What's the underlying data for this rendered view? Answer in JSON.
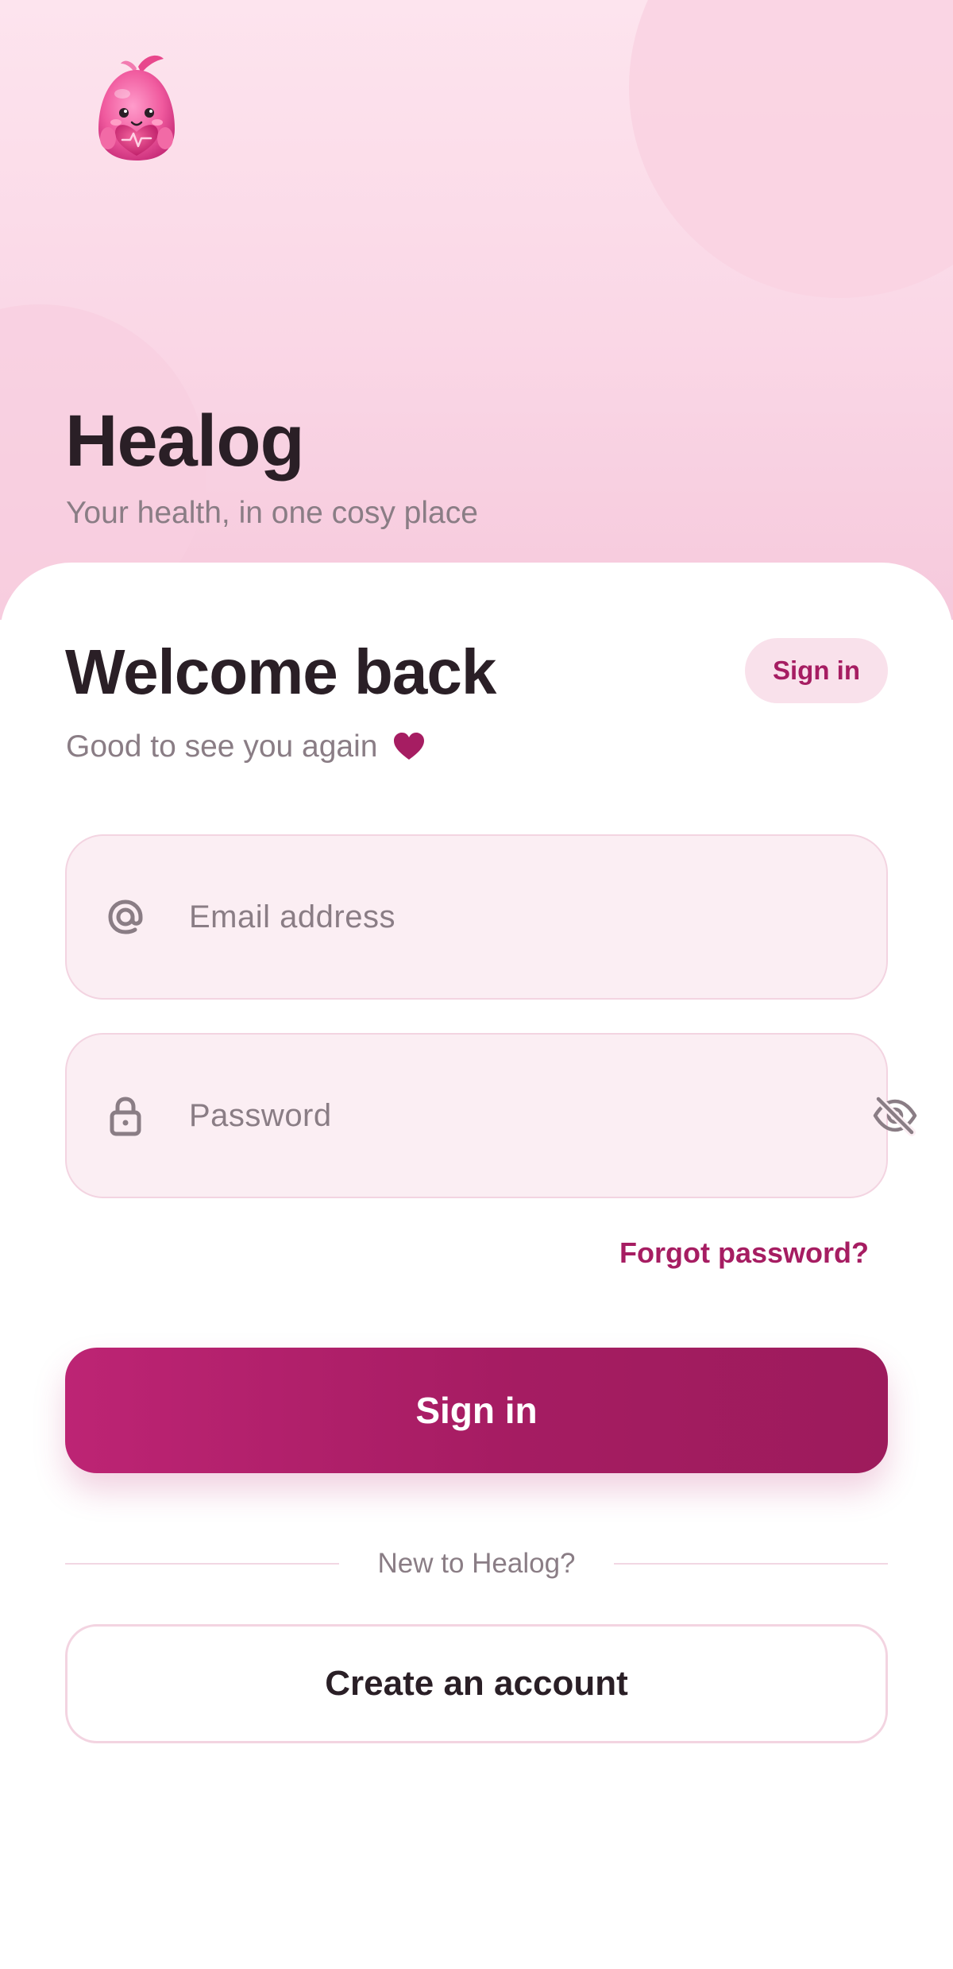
{
  "app": {
    "name": "Healog",
    "tagline": "Your health, in one cosy place"
  },
  "card": {
    "title": "Welcome back",
    "mode_pill": "Sign in",
    "subtitle": "Good to see you again"
  },
  "form": {
    "email": {
      "placeholder": "Email address",
      "value": "",
      "icon": "at-icon"
    },
    "password": {
      "placeholder": "Password",
      "value": "",
      "icon": "lock-icon",
      "toggle_icon": "eye-off-icon"
    },
    "forgot_label": "Forgot password?",
    "submit_label": "Sign in"
  },
  "signup": {
    "divider_label": "New to Healog?",
    "create_label": "Create an account"
  },
  "colors": {
    "accent": "#a61d62",
    "hero_bg": "#fad7e6",
    "field_bg": "#fbeef3",
    "text_primary": "#2a1f26",
    "text_muted": "#8a7d85"
  }
}
